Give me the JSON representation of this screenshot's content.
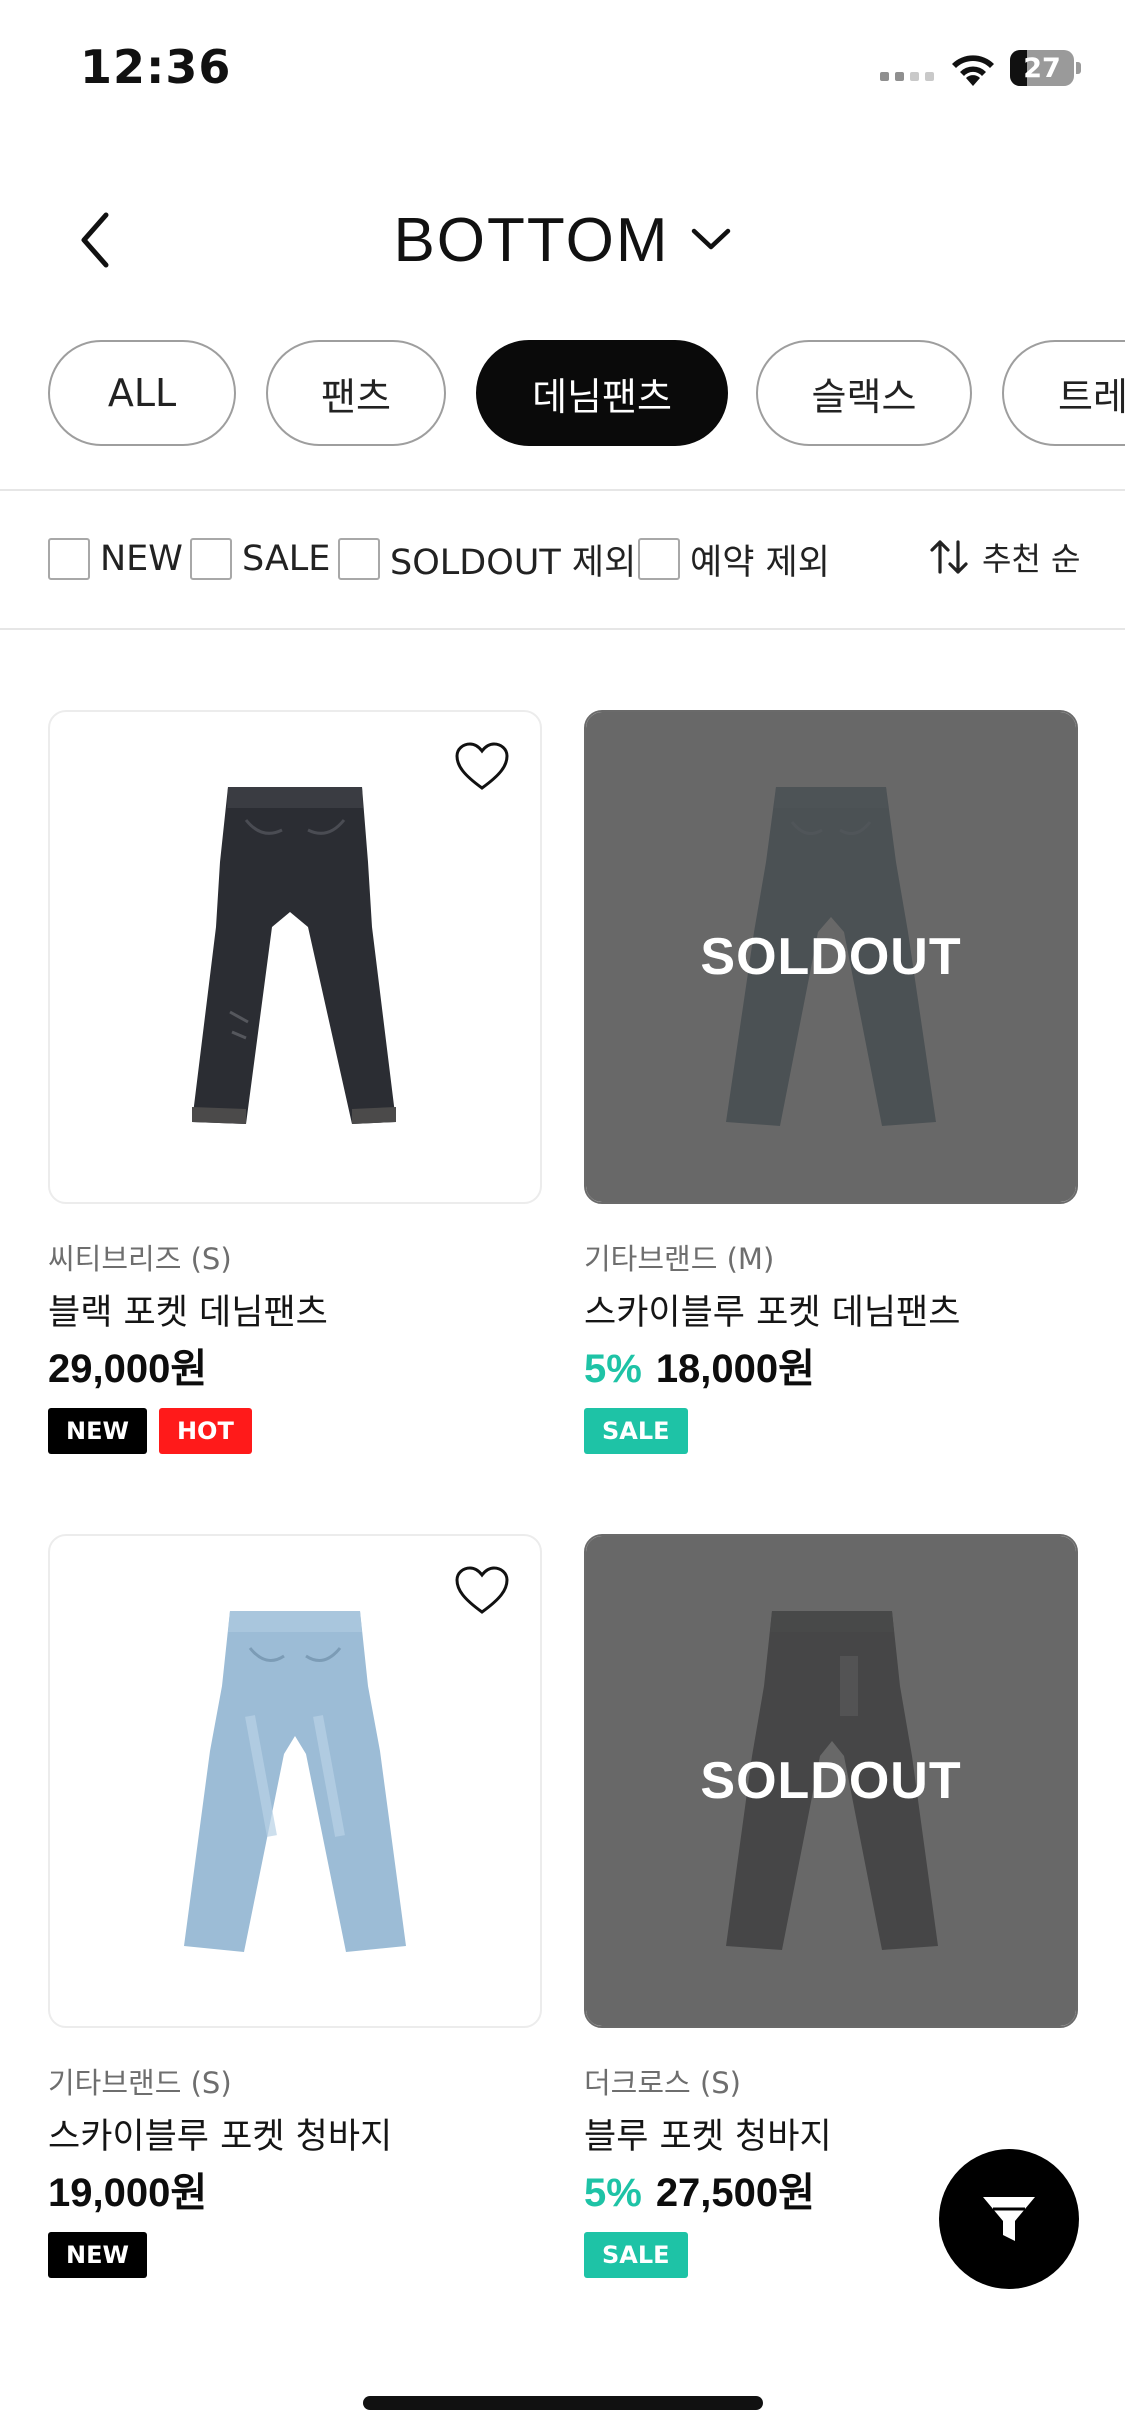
{
  "status_bar": {
    "time": "12:36",
    "battery": "27",
    "battery_level": 0.27
  },
  "header": {
    "title": "BOTTOM"
  },
  "categories": [
    {
      "label": "ALL",
      "active": false
    },
    {
      "label": "팬츠",
      "active": false
    },
    {
      "label": "데님팬츠",
      "active": true
    },
    {
      "label": "슬랙스",
      "active": false
    },
    {
      "label": "트레",
      "active": false
    }
  ],
  "filters": [
    {
      "label": "NEW",
      "checked": false
    },
    {
      "label": "SALE",
      "checked": false
    },
    {
      "label": "SOLDOUT 제외",
      "checked": false
    },
    {
      "label": "예약 제외",
      "checked": false
    }
  ],
  "sort": {
    "label": "추천 순"
  },
  "colors": {
    "accent_discount": "#1ec3a6",
    "badge_new": "#000000",
    "badge_hot": "#ff1a1a",
    "badge_sale": "#1ec3a6"
  },
  "products": [
    {
      "brand": "씨티브리즈 (S)",
      "name": "블랙 포켓 데님팬츠",
      "discount": "",
      "price": "29,000원",
      "soldout": false,
      "soldout_text": "",
      "badges": [
        "NEW",
        "HOT"
      ]
    },
    {
      "brand": "기타브랜드 (M)",
      "name": "스카이블루 포켓 데님팬츠",
      "discount": "5%",
      "price": "18,000원",
      "soldout": true,
      "soldout_text": "SOLDOUT",
      "badges": [
        "SALE"
      ]
    },
    {
      "brand": "기타브랜드 (S)",
      "name": "스카이블루 포켓 청바지",
      "discount": "",
      "price": "19,000원",
      "soldout": false,
      "soldout_text": "",
      "badges": [
        "NEW"
      ]
    },
    {
      "brand": "더크로스 (S)",
      "name": "블루 포켓 청바지",
      "discount": "5%",
      "price": "27,500원",
      "soldout": true,
      "soldout_text": "SOLDOUT",
      "badges": [
        "SALE"
      ]
    }
  ]
}
